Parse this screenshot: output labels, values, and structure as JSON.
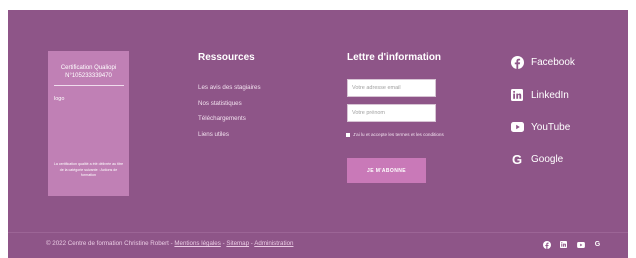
{
  "certification": {
    "title": "Certification Qualiopi N°105233339470",
    "logo_label": "logo",
    "note": "La certification qualité a été délivrée au titre de la catégorie suivante : Actions de formation"
  },
  "resources": {
    "title": "Ressources",
    "links": [
      "Les avis des stagiaires",
      "Nos statistiques",
      "Téléchargements",
      "Liens utiles"
    ]
  },
  "newsletter": {
    "title": "Lettre d'information",
    "email_placeholder": "Votre adresse email",
    "firstname_placeholder": "Votre prénom",
    "consent": "J'ai lu et accepte les termes et les conditions",
    "subscribe_label": "JE M'ABONNE"
  },
  "social": {
    "facebook": "Facebook",
    "linkedin": "LinkedIn",
    "youtube": "YouTube",
    "google": "Google"
  },
  "footer": {
    "copyright": "© 2022 Centre de formation Christine Robert -",
    "sep": "-",
    "legal": "Mentions légales",
    "sitemap": "Sitemap",
    "admin": "Administration"
  },
  "colors": {
    "background": "#8e5588",
    "card": "#c080b5",
    "button": "#c979b8"
  }
}
